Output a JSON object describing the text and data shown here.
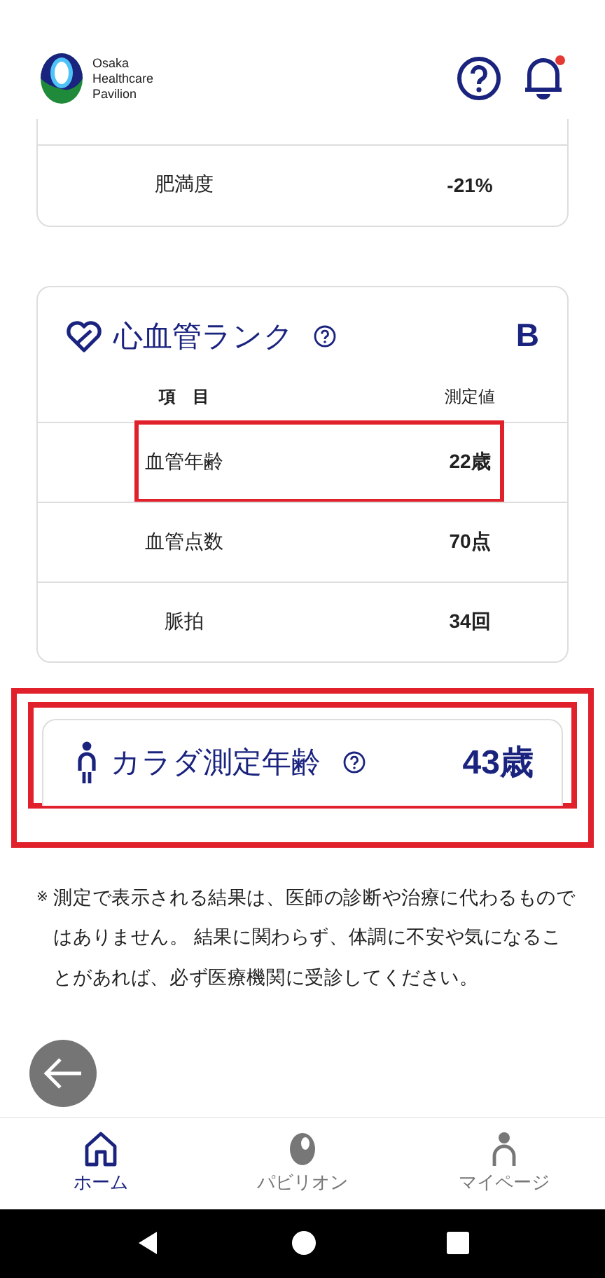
{
  "header": {
    "logo_lines": [
      "Osaka",
      "Healthcare",
      "Pavilion"
    ],
    "notification_unread": true
  },
  "body_fat_card": {
    "rows": [
      {
        "item": "肥満度",
        "value": "-21%"
      }
    ]
  },
  "cardio_card": {
    "title": "心血管ランク",
    "rank": "B",
    "columns": [
      "項　目",
      "測定値"
    ],
    "rows": [
      {
        "item": "血管年齢",
        "value": "22歳",
        "highlighted": true
      },
      {
        "item": "血管点数",
        "value": "70点",
        "highlighted": false
      },
      {
        "item": "脈拍",
        "value": "34回",
        "highlighted": false
      }
    ]
  },
  "body_age_card": {
    "title": "カラダ測定年齢",
    "value": "43歳",
    "highlighted": true
  },
  "note": {
    "mark": "※",
    "text": "測定で表示される結果は、医師の診断や治療に代わるものではありません。 結果に関わらず、体調に不安や気になることがあれば、必ず医療機関に受診してください。"
  },
  "bottom_nav": [
    {
      "kind": "home",
      "label": "ホーム",
      "selected": true
    },
    {
      "kind": "pavilion",
      "label": "パビリオン",
      "selected": false
    },
    {
      "kind": "mypage",
      "label": "マイページ",
      "selected": false
    }
  ]
}
